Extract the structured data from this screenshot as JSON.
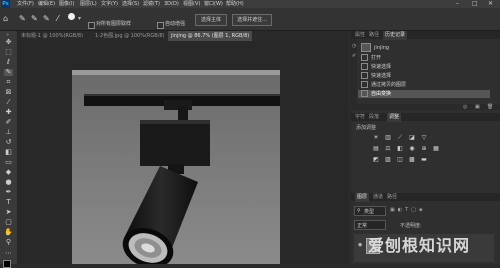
{
  "app": {
    "logo": "Ps"
  },
  "menubar": {
    "items": [
      "文件(F)",
      "编辑(E)",
      "图像(I)",
      "图层(L)",
      "文字(Y)",
      "选择(S)",
      "滤镜(T)",
      "3D(D)",
      "视图(V)",
      "窗口(W)",
      "帮助(H)"
    ],
    "win": {
      "min": "–",
      "max": "□",
      "close": "✕"
    }
  },
  "options": {
    "check_all_layers": "对所有图层取样",
    "check_auto_enhance": "自动增强",
    "btn_select_subject": "选择主体",
    "btn_select_mask": "选择并遮住..."
  },
  "tabs": [
    {
      "label": "未标题-1 @ 100%(RGB/8)",
      "active": false
    },
    {
      "label": "1-2色图.jpg @ 100%(RGB/8)",
      "active": false
    },
    {
      "label": "jinjing @ 86.7% (图层 1, RGB/8)",
      "active": true
    }
  ],
  "right": {
    "history_tabs": [
      "属性",
      "路径",
      "历史记录"
    ],
    "history_title": "jinjing",
    "history_items": [
      "打开",
      "快速选择",
      "快速选择",
      "通过拷贝的图层",
      "自由变换"
    ],
    "adj_tabs": [
      "字符",
      "段落",
      "调整"
    ],
    "adj_title": "添加调整",
    "layers_tabs": [
      "图层",
      "通道",
      "路径"
    ],
    "layers_kind": "类型",
    "layers_mode": "正常",
    "layers_opacity": "不透明度:"
  },
  "watermark": "爱刨根知识网"
}
